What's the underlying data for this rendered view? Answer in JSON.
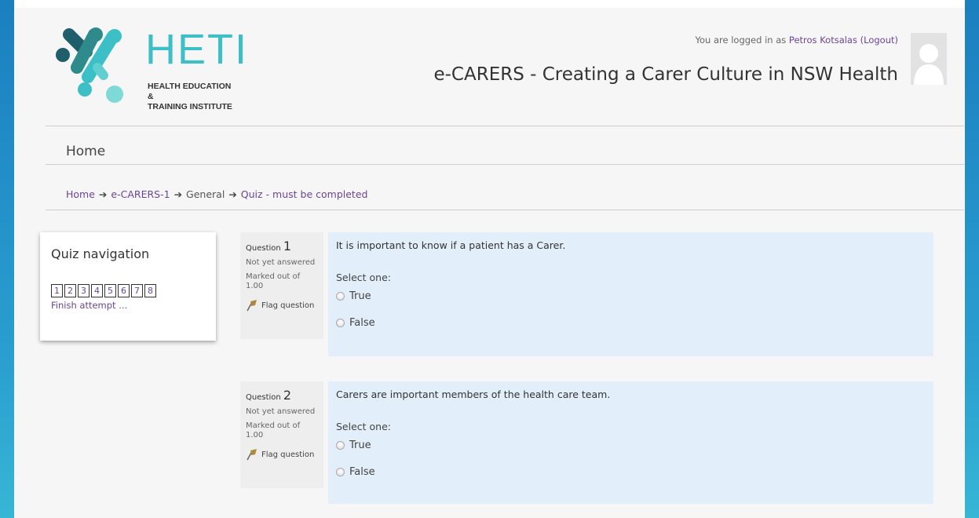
{
  "header": {
    "logo_text": "HETI",
    "logo_sub": [
      "HEALTH EDUCATION &",
      "TRAINING INSTITUTE"
    ],
    "login_prefix": "You are logged in as ",
    "user_name": "Petros Kotsalas",
    "logout": "(Logout)",
    "site_title": "e-CARERS - Creating a Carer Culture in NSW Health"
  },
  "nav": {
    "home": "Home"
  },
  "breadcrumb": {
    "items": [
      "Home",
      "e-CARERS-1",
      "General",
      "Quiz - must be completed"
    ],
    "separator": "➔"
  },
  "quiz_nav": {
    "title": "Quiz navigation",
    "buttons": [
      "1",
      "2",
      "3",
      "4",
      "5",
      "6",
      "7",
      "8"
    ],
    "finish": "Finish attempt ..."
  },
  "questions": [
    {
      "label": "Question",
      "number": "1",
      "state": "Not yet answered",
      "marked": "Marked out of 1.00",
      "flag": "Flag question",
      "text": "It is important to know if a patient has a Carer.",
      "prompt": "Select one:",
      "options": [
        "True",
        "False"
      ]
    },
    {
      "label": "Question",
      "number": "2",
      "state": "Not yet answered",
      "marked": "Marked out of 1.00",
      "flag": "Flag question",
      "text": "Carers are important members of the health care team.",
      "prompt": "Select one:",
      "options": [
        "True",
        "False"
      ]
    }
  ],
  "colors": {
    "side_bar": "#2a9fd0",
    "link": "#6b4596",
    "logo_teal": "#3cbfc7",
    "logo_dark": "#1f5f6b",
    "question_bg": "#e2eef9",
    "info_bg": "#eeeeee"
  }
}
